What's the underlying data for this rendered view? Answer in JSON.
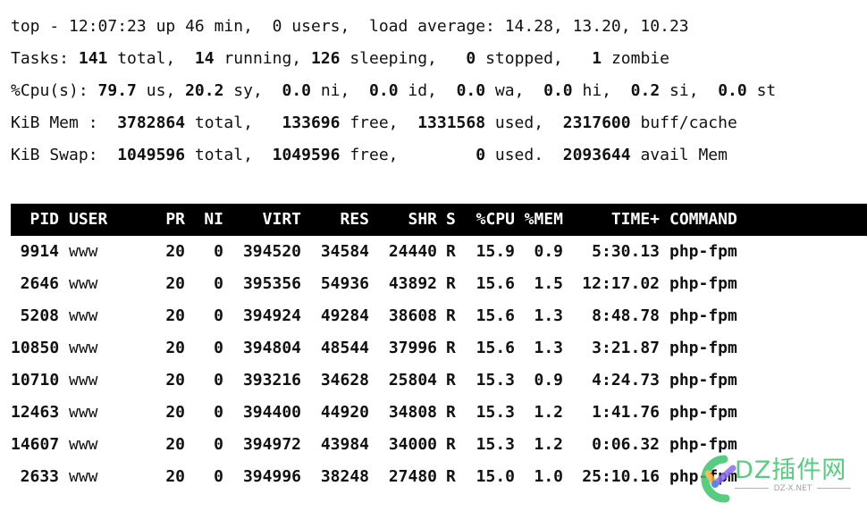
{
  "summary": {
    "uptime_line": {
      "prefix": "top - ",
      "time": "12:07:23",
      "uptime": " up 46 min,  ",
      "users": "0",
      "users_label": " users,  load average: ",
      "load_avg": "14.28, 13.20, 10.23"
    },
    "tasks": {
      "label": "Tasks: ",
      "total": "141",
      "total_label": " total,  ",
      "running": "14",
      "running_label": " running, ",
      "sleeping": "126",
      "sleeping_label": " sleeping,   ",
      "stopped": "0",
      "stopped_label": " stopped,   ",
      "zombie": "1",
      "zombie_label": " zombie"
    },
    "cpu": {
      "label": "%Cpu(s): ",
      "us": "79.7",
      "us_label": " us, ",
      "sy": "20.2",
      "sy_label": " sy,  ",
      "ni": "0.0",
      "ni_label": " ni,  ",
      "id": "0.0",
      "id_label": " id,  ",
      "wa": "0.0",
      "wa_label": " wa,  ",
      "hi": "0.0",
      "hi_label": " hi,  ",
      "si": "0.2",
      "si_label": " si,  ",
      "st": "0.0",
      "st_label": " st"
    },
    "mem": {
      "label": "KiB Mem :  ",
      "total": "3782864",
      "total_label": " total,   ",
      "free": "133696",
      "free_label": " free,  ",
      "used": "1331568",
      "used_label": " used,  ",
      "buff_cache": "2317600",
      "buff_cache_label": " buff/cache"
    },
    "swap": {
      "label": "KiB Swap:  ",
      "total": "1049596",
      "total_label": " total,  ",
      "free": "1049596",
      "free_label": " free,        ",
      "used": "0",
      "used_label": " used.  ",
      "avail": "2093644",
      "avail_label": " avail Mem"
    }
  },
  "table": {
    "headers": {
      "pid": "PID",
      "user": "USER",
      "pr": "PR",
      "ni": "NI",
      "virt": "VIRT",
      "res": "RES",
      "shr": "SHR",
      "s": "S",
      "cpu": "%CPU",
      "mem": "%MEM",
      "time": "TIME+",
      "command": "COMMAND"
    },
    "rows": [
      {
        "pid": "9914",
        "user": "www",
        "pr": "20",
        "ni": "0",
        "virt": "394520",
        "res": "34584",
        "shr": "24440",
        "s": "R",
        "cpu": "15.9",
        "mem": "0.9",
        "time": "5:30.13",
        "command": "php-fpm"
      },
      {
        "pid": "2646",
        "user": "www",
        "pr": "20",
        "ni": "0",
        "virt": "395356",
        "res": "54936",
        "shr": "43892",
        "s": "R",
        "cpu": "15.6",
        "mem": "1.5",
        "time": "12:17.02",
        "command": "php-fpm"
      },
      {
        "pid": "5208",
        "user": "www",
        "pr": "20",
        "ni": "0",
        "virt": "394924",
        "res": "49284",
        "shr": "38608",
        "s": "R",
        "cpu": "15.6",
        "mem": "1.3",
        "time": "8:48.78",
        "command": "php-fpm"
      },
      {
        "pid": "10850",
        "user": "www",
        "pr": "20",
        "ni": "0",
        "virt": "394804",
        "res": "48544",
        "shr": "37996",
        "s": "R",
        "cpu": "15.6",
        "mem": "1.3",
        "time": "3:21.87",
        "command": "php-fpm"
      },
      {
        "pid": "10710",
        "user": "www",
        "pr": "20",
        "ni": "0",
        "virt": "393216",
        "res": "34628",
        "shr": "25804",
        "s": "R",
        "cpu": "15.3",
        "mem": "0.9",
        "time": "4:24.73",
        "command": "php-fpm"
      },
      {
        "pid": "12463",
        "user": "www",
        "pr": "20",
        "ni": "0",
        "virt": "394400",
        "res": "44920",
        "shr": "34808",
        "s": "R",
        "cpu": "15.3",
        "mem": "1.2",
        "time": "1:41.76",
        "command": "php-fpm"
      },
      {
        "pid": "14607",
        "user": "www",
        "pr": "20",
        "ni": "0",
        "virt": "394972",
        "res": "43984",
        "shr": "34000",
        "s": "R",
        "cpu": "15.3",
        "mem": "1.2",
        "time": "0:06.32",
        "command": "php-fpm"
      },
      {
        "pid": "2633",
        "user": "www",
        "pr": "20",
        "ni": "0",
        "virt": "394996",
        "res": "38248",
        "shr": "27480",
        "s": "R",
        "cpu": "15.0",
        "mem": "1.0",
        "time": "25:10.16",
        "command": "php-fpm"
      }
    ]
  },
  "watermark": {
    "text": "DZ插件网",
    "subtext": "DZ-X.NET",
    "colors": {
      "green": "#3cc46a",
      "orange": "#f5b03c",
      "purple": "#8a6cf0",
      "blue": "#3b6ff0"
    }
  }
}
